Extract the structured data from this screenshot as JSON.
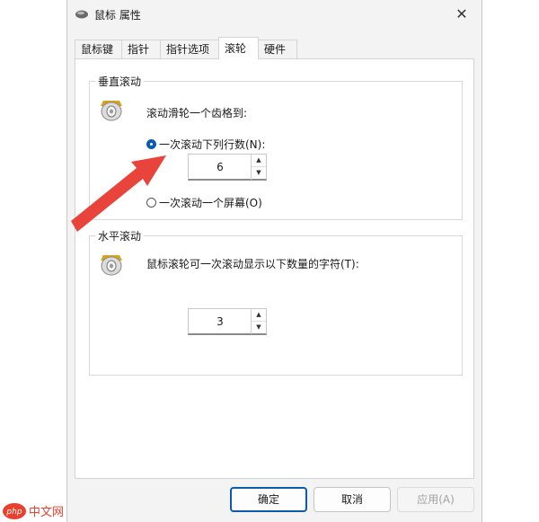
{
  "window": {
    "title": "鼠标 属性",
    "close_glyph": "✕"
  },
  "tabs": [
    {
      "label": "鼠标键"
    },
    {
      "label": "指针"
    },
    {
      "label": "指针选项"
    },
    {
      "label": "滚轮",
      "active": true
    },
    {
      "label": "硬件"
    }
  ],
  "vertical": {
    "group_label": "垂直滚动",
    "prompt": "滚动滑轮一个齿格到:",
    "option_lines": "一次滚动下列行数(N):",
    "option_lines_selected": true,
    "lines_value": "6",
    "option_screen": "一次滚动一个屏幕(O)",
    "option_screen_selected": false
  },
  "horizontal": {
    "group_label": "水平滚动",
    "prompt": "鼠标滚轮可一次滚动显示以下数量的字符(T):",
    "chars_value": "3"
  },
  "buttons": {
    "ok": "确定",
    "cancel": "取消",
    "apply": "应用(A)"
  },
  "spin": {
    "up_glyph": "▲",
    "down_glyph": "▼"
  },
  "watermark": {
    "text": "php 中文网"
  },
  "colors": {
    "accent": "#0b5cad",
    "arrow": "#e8443c",
    "watermark": "#e8412d"
  },
  "icons": {
    "title": "mouse-icon",
    "group": "mouse-wheel-icon",
    "annotation": "red-arrow"
  }
}
